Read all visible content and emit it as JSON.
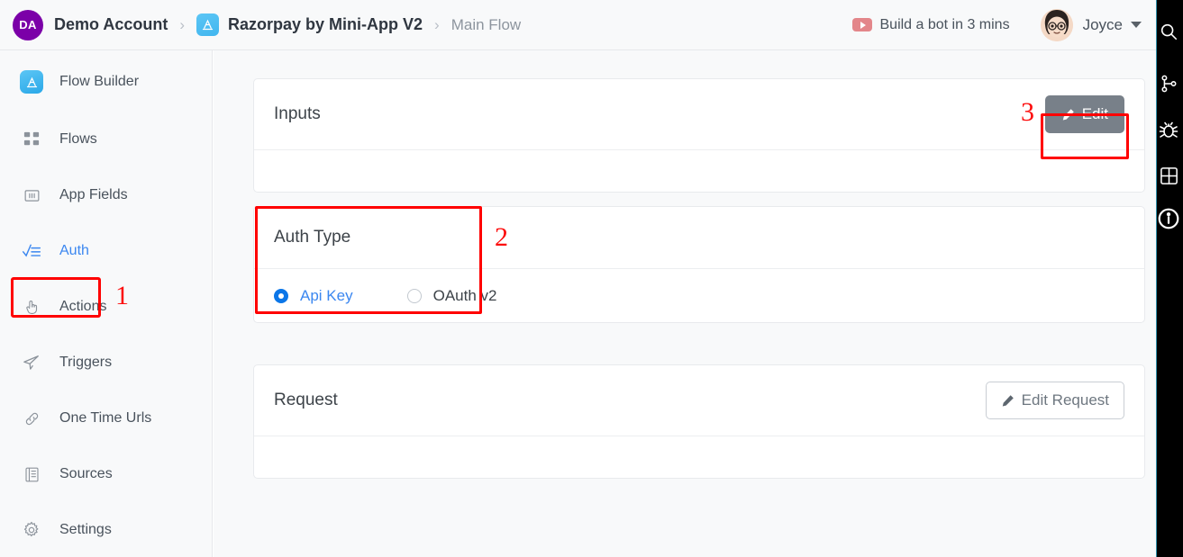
{
  "header": {
    "account_initials": "DA",
    "account_name": "Demo Account",
    "separator": "›",
    "app_name": "Razorpay by Mini-App V2",
    "flow_name": "Main Flow",
    "promo_label": "Build a bot in 3 mins",
    "promo_icon": "youtube-play-icon",
    "user_name": "Joyce",
    "user_avatar_icon": "avatar",
    "caret_icon": "chevron-down-icon",
    "account_avatar_color": "#7b00a8"
  },
  "sidebar": {
    "items": [
      {
        "label": "Flow Builder",
        "icon": "flow-builder-icon",
        "active": false
      },
      {
        "label": "Flows",
        "icon": "grid-icon",
        "active": false
      },
      {
        "label": "App Fields",
        "icon": "app-fields-icon",
        "active": false
      },
      {
        "label": "Auth",
        "icon": "auth-check-icon",
        "active": true
      },
      {
        "label": "Actions",
        "icon": "hand-click-icon",
        "active": false
      },
      {
        "label": "Triggers",
        "icon": "paper-plane-icon",
        "active": false
      },
      {
        "label": "One Time Urls",
        "icon": "link-icon",
        "active": false
      },
      {
        "label": "Sources",
        "icon": "book-icon",
        "active": false
      },
      {
        "label": "Settings",
        "icon": "gear-icon",
        "active": false
      }
    ]
  },
  "annotations": {
    "one": "1",
    "two": "2",
    "three": "3",
    "color": "#fc0d0d"
  },
  "cards": {
    "inputs": {
      "title": "Inputs",
      "edit_label": "Edit",
      "edit_icon": "pencil-icon"
    },
    "auth": {
      "title": "Auth Type",
      "options": [
        {
          "label": "Api Key",
          "selected": true
        },
        {
          "label": "OAuth v2",
          "selected": false
        }
      ]
    },
    "request": {
      "title": "Request",
      "edit_label": "Edit Request",
      "edit_icon": "pencil-icon"
    }
  },
  "rail": {
    "icons": [
      "search-icon",
      "branch-icon",
      "bug-icon",
      "grid-icon",
      "info-icon"
    ]
  },
  "colors": {
    "accent_blue": "#3b87f0",
    "radio_blue": "#0b76e8",
    "annotation_red": "#ff0000",
    "page_bg": "#f8f9fa",
    "secondary_btn": "#788089"
  }
}
